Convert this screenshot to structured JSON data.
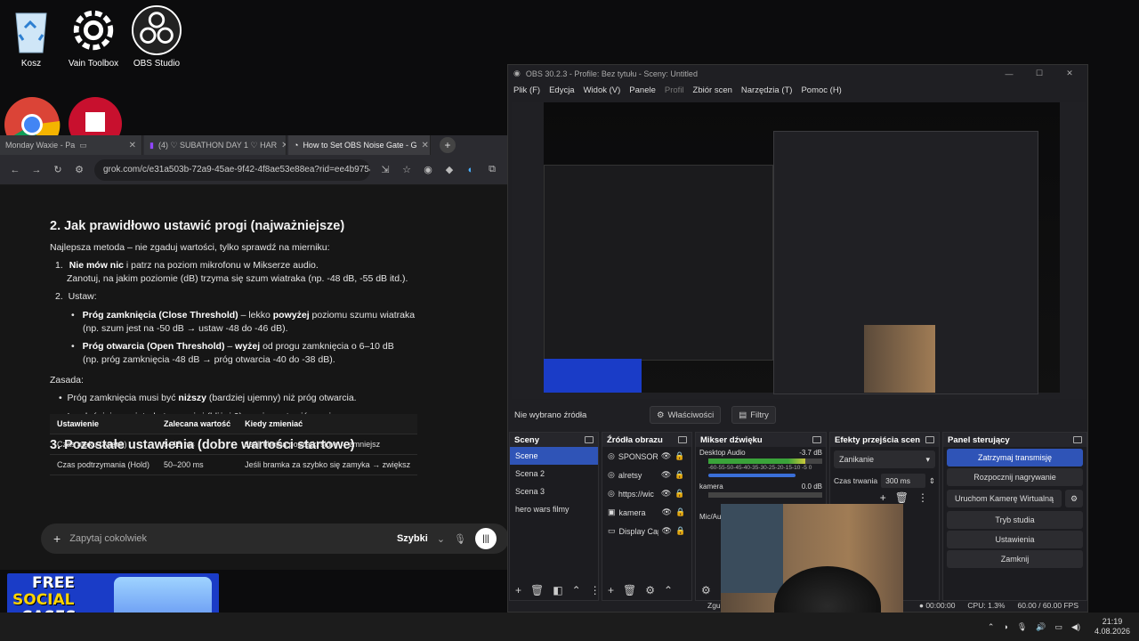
{
  "desktop": {
    "icons": [
      {
        "label": "Kosz",
        "icon": "recycle-bin-icon"
      },
      {
        "label": "Vain Toolbox",
        "icon": "gear-icon"
      },
      {
        "label": "OBS Studio",
        "icon": "obs-icon"
      }
    ]
  },
  "browser": {
    "tabs": [
      {
        "label": "Monday Waxie - Pa"
      },
      {
        "label": "(4) ♡ SUBATHON DAY 1 ♡ HAR"
      },
      {
        "label": "How to Set OBS Noise Gate - G"
      }
    ],
    "url": "grok.com/c/e31a503b-72a9-45ae-9f42-4f8ae53e88ea?rid=ee4b9758-19f5-4002-a75d-1c",
    "article": {
      "h2": "2. Jak prawidłowo ustawić progi (najważniejsze)",
      "intro": "Najlepsza metoda – nie zgaduj wartości, tylko sprawdź na mierniku:",
      "step1_bold": "Nie mów nic",
      "step1_rest": " i patrz na poziom mikrofonu w Mikserze audio.",
      "step1_line2": "Zanotuj, na jakim poziomie (dB) trzyma się szum wiatraka (np. -48 dB, -55 dB itd.).",
      "step2": "Ustaw:",
      "bullet1_bold": "Próg zamknięcia (Close Threshold)",
      "bullet1_mid": " – lekko ",
      "bullet1_bold2": "powyżej",
      "bullet1_rest": " poziomu szumu wiatraka",
      "bullet1_line2": "(np. szum jest na -50 dB → ustaw -48 do -46 dB).",
      "bullet2_bold": "Próg otwarcia (Open Threshold)",
      "bullet2_mid": " – ",
      "bullet2_bold2": "wyżej",
      "bullet2_rest": " od progu zamknięcia o 6–10 dB",
      "bullet2_line2": "(np. próg zamknięcia -48 dB → próg otwarcia -40 do -38 dB).",
      "rule_label": "Zasada:",
      "rule1_a": "Próg zamknięcia musi być ",
      "rule1_bold": "niższy",
      "rule1_b": " (bardziej ujemny) niż próg otwarcia.",
      "rule2": "Im głośniejszy wiatrak, tym wyżej (bliżej 0) musisz ustawić progi.",
      "h3": "3. Pozostałe ustawienia (dobre wartości startowe)",
      "table_headers": [
        "Ustawienie",
        "Zalecana wartość",
        "Kiedy zmieniać"
      ],
      "table_rows": [
        [
          "Czas ataku (Attack)",
          "5–15 ms",
          "Jeśli obcina początki słów → zmniejsz"
        ],
        [
          "Czas podtrzymania (Hold)",
          "50–200 ms",
          "Jeśli bramka za szybko się zamyka → zwiększ"
        ]
      ],
      "chat_placeholder": "Zapytaj cokolwiek",
      "chat_mode": "Szybki"
    }
  },
  "obs": {
    "title": "OBS 30.2.3 - Profile: Bez tytułu - Sceny: Untitled",
    "menu": [
      "Plik (F)",
      "Edycja",
      "Widok (V)",
      "Panele",
      "Profil",
      "Zbiór scen",
      "Narzędzia (T)",
      "Pomoc (H)"
    ],
    "no_source": "Nie wybrano źródła",
    "properties": "Właściwości",
    "filters": "Filtry",
    "scenes_title": "Sceny",
    "scenes": [
      "Scene",
      "Scena 2",
      "Scena 3",
      "hero wars filmy"
    ],
    "sources_title": "Źródła obrazu",
    "sources": [
      "SPONSOR2",
      "alretsy",
      "https://wic",
      "kamera",
      "Display Cap"
    ],
    "mixer_title": "Mikser dźwięku",
    "mixer": [
      {
        "name": "Desktop Audio",
        "db": "-3.7 dB"
      },
      {
        "name": "kamera",
        "db": "0.0 dB"
      },
      {
        "name": "Mic/Aux",
        "db": ""
      }
    ],
    "mixer_scale": "-60-55-50-45-40-35-30-25-20-15-10 -5 0",
    "transitions_title": "Efekty przejścia scen",
    "transition": "Zanikanie",
    "duration_label": "Czas trwania",
    "duration": "300 ms",
    "control_title": "Panel sterujący",
    "controls": [
      "Zatrzymaj transmisję",
      "Rozpocznij nagrywanie",
      "Uruchom Kamerę Wirtualną",
      "Tryb studia",
      "Ustawienia",
      "Zamknij"
    ],
    "status_time": "00:00:00",
    "cpu": "CPU: 1.3%",
    "fps": "60.00 / 60.00 FPS",
    "status_partial": "Zgu"
  },
  "overlay": {
    "line1": "FREE",
    "line2": "SOCIAL",
    "line3": "CASES"
  },
  "taskbar": {
    "time": "21:19",
    "date": "4.08.2026"
  }
}
